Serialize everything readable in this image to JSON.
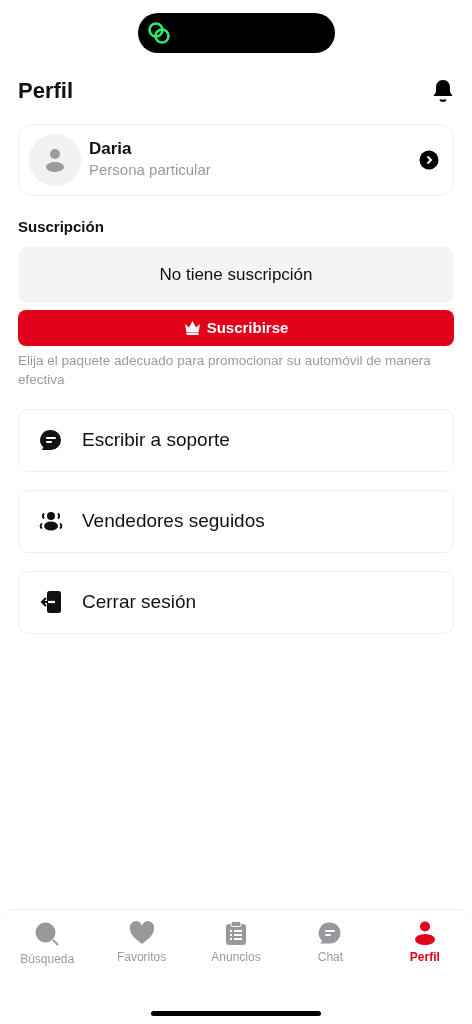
{
  "header": {
    "title": "Perfil"
  },
  "profile": {
    "name": "Daria",
    "type": "Persona particular"
  },
  "subscription": {
    "heading": "Suscripción",
    "status": "No tiene suscripción",
    "button": "Suscribirse",
    "hint": "Elija el paquete adecuado para promocionar su automóvil de manera efectiva"
  },
  "menu": [
    {
      "kind": "support",
      "label": "Escribir a soporte"
    },
    {
      "kind": "sellers",
      "label": "Vendedores seguidos"
    },
    {
      "kind": "logout",
      "label": "Cerrar sesión"
    }
  ],
  "tab_bar": [
    {
      "kind": "search",
      "label": "Búsqueda",
      "selected": false
    },
    {
      "kind": "favorites",
      "label": "Favoritos",
      "selected": false
    },
    {
      "kind": "ads",
      "label": "Anuncios",
      "selected": false
    },
    {
      "kind": "chat",
      "label": "Chat",
      "selected": false
    },
    {
      "kind": "profile",
      "label": "Perfil",
      "selected": true
    }
  ]
}
